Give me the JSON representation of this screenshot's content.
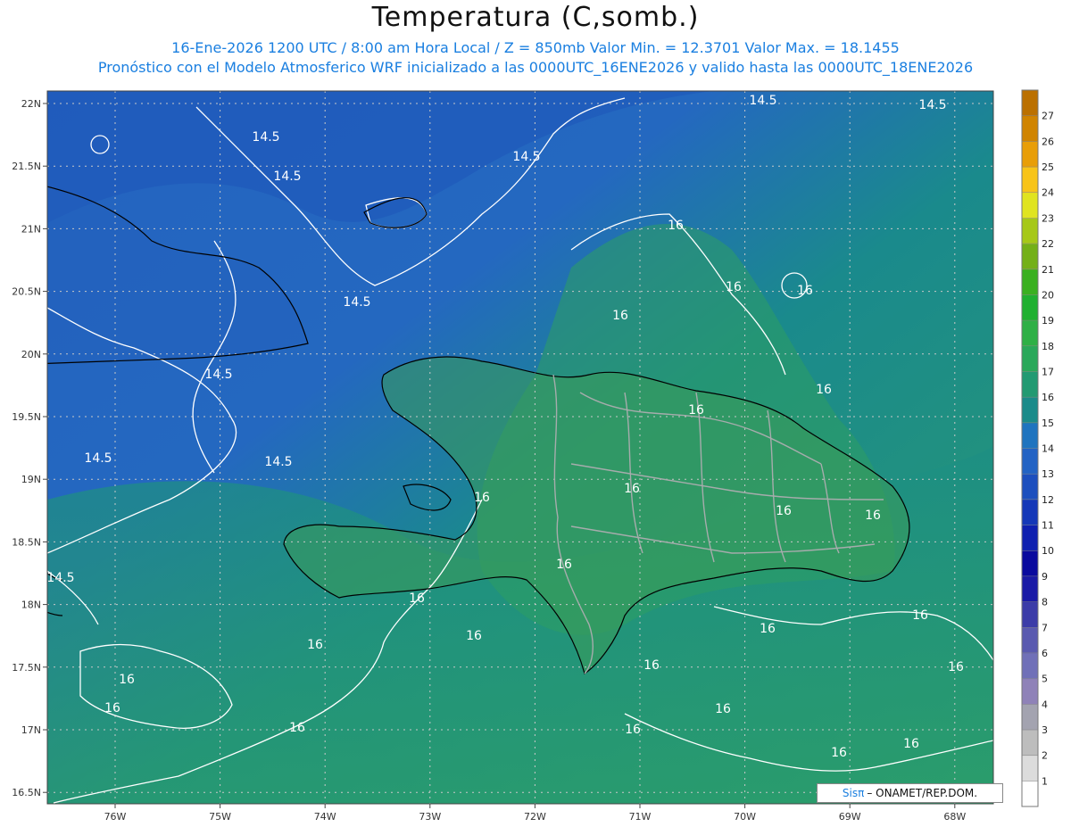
{
  "header": {
    "title": "Temperatura (C,somb.)",
    "subtitle_line1": "16-Ene-2026  1200 UTC / 8:00 am Hora Local / Z = 850mb    Valor Min. = 12.3701  Valor Max. = 18.1455",
    "subtitle_line2": "Pronóstico con el Modelo Atmosferico WRF inicializado a las 0000UTC_16ENE2026 y valido hasta las  0000UTC_18ENE2026"
  },
  "credit": {
    "brand": "Sisπ",
    "org": "– ONAMET/REP.DOM."
  },
  "map": {
    "lat_labels": [
      "22N",
      "21.5N",
      "21N",
      "20.5N",
      "20N",
      "19.5N",
      "19N",
      "18.5N",
      "18N",
      "17.5N",
      "17N",
      "16.5N"
    ],
    "lon_labels": [
      "76W",
      "75W",
      "74W",
      "73W",
      "72W",
      "71W",
      "70W",
      "69W",
      "68W"
    ],
    "contour_labels": [
      "14.5",
      "14.5",
      "14.5",
      "14.5",
      "14.5",
      "14.5",
      "14.5",
      "14.5",
      "14.5",
      "14.5",
      "16",
      "16",
      "16",
      "16",
      "16",
      "16",
      "16",
      "16",
      "16",
      "16",
      "16",
      "16",
      "16",
      "16",
      "16",
      "16",
      "16",
      "16",
      "16",
      "16",
      "16",
      "16",
      "16",
      "16",
      "16"
    ],
    "colors": {
      "cold": "#2a6ec4",
      "mid": "#1a8e88",
      "warm": "#2d9e6a",
      "land": "#3b9a5a",
      "contour": "#ffffff",
      "coast": "#000000",
      "province_border": "#9aa0a0",
      "grid": "#cccccc"
    }
  },
  "colorbar": {
    "labels": [
      "1",
      "2",
      "3",
      "4",
      "5",
      "6",
      "7",
      "8",
      "9",
      "10",
      "11",
      "12",
      "13",
      "14",
      "15",
      "16",
      "17",
      "18",
      "19",
      "20",
      "21",
      "22",
      "23",
      "24",
      "25",
      "26",
      "27"
    ],
    "colors": [
      "#ffffff",
      "#dcdcdc",
      "#bdbdbd",
      "#a3a3b0",
      "#8f82b8",
      "#7070b8",
      "#5a5ab0",
      "#3c3ca8",
      "#1a1aa6",
      "#0a0a9e",
      "#0f20b0",
      "#1538b8",
      "#1d4fbe",
      "#2363c4",
      "#1f74bf",
      "#1a8b8a",
      "#229a72",
      "#2aa85a",
      "#2fb046",
      "#20b030",
      "#3ab020",
      "#74b018",
      "#a6c818",
      "#e0e420",
      "#f8c418",
      "#e89e08",
      "#d08400",
      "#bb7000"
    ]
  }
}
